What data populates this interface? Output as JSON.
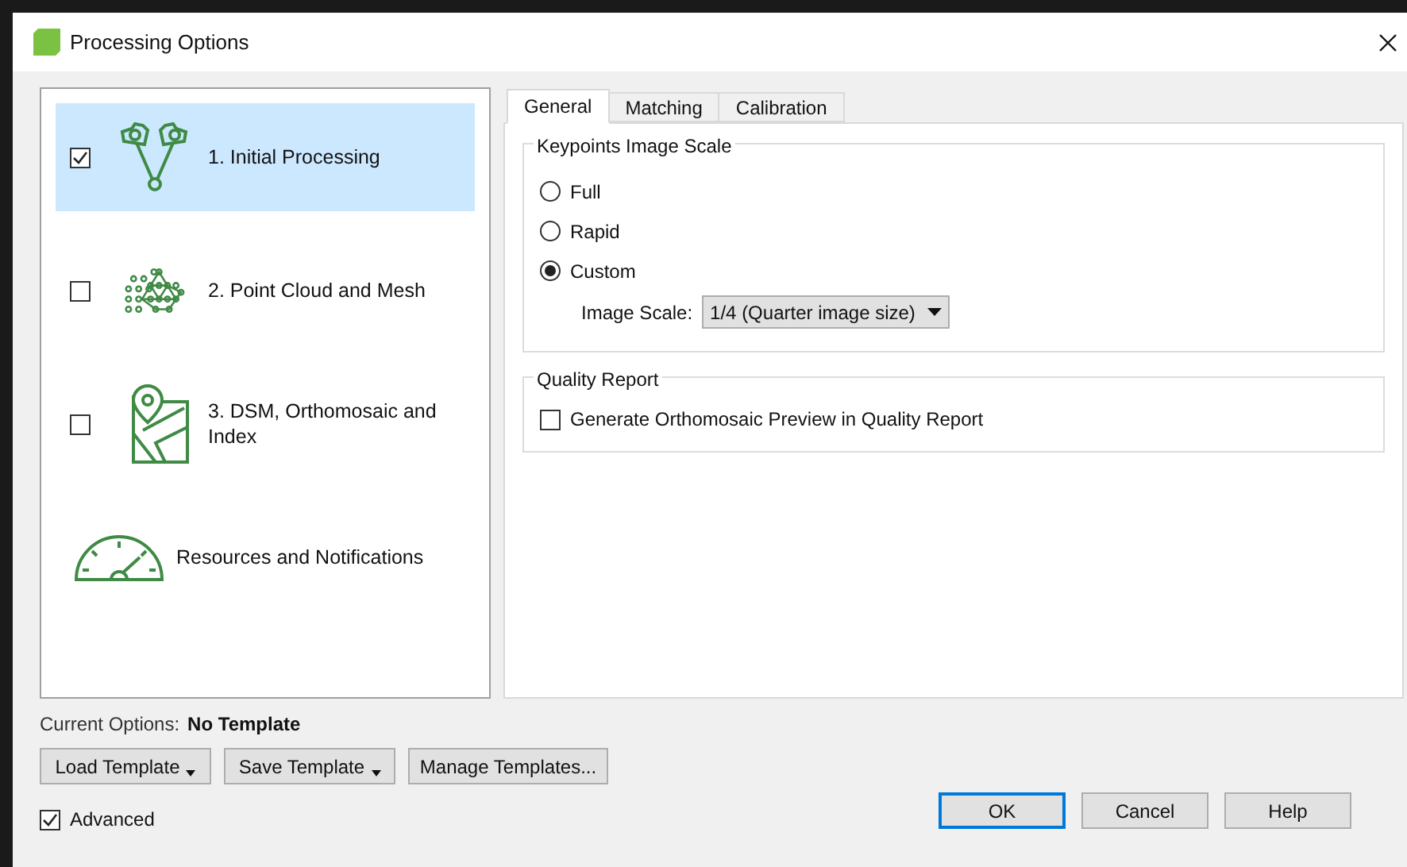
{
  "window": {
    "title": "Processing Options"
  },
  "steps": [
    {
      "kind": "cameras",
      "label": "1. Initial Processing",
      "checked": true,
      "selected": true
    },
    {
      "kind": "pointcloud",
      "label": "2. Point Cloud and Mesh",
      "checked": false,
      "selected": false
    },
    {
      "kind": "map",
      "label": "3. DSM, Orthomosaic and Index",
      "checked": false,
      "selected": false
    },
    {
      "kind": "gauge",
      "label": "Resources and Notifications",
      "selected": false
    }
  ],
  "tabs": [
    {
      "label": "General",
      "selected": true
    },
    {
      "label": "Matching",
      "selected": false
    },
    {
      "label": "Calibration",
      "selected": false
    }
  ],
  "keypoints": {
    "title": "Keypoints Image Scale",
    "options": [
      {
        "label": "Full",
        "selected": false
      },
      {
        "label": "Rapid",
        "selected": false
      },
      {
        "label": "Custom",
        "selected": true
      }
    ],
    "scale_label": "Image Scale:",
    "scale_value": "1/4 (Quarter image size)"
  },
  "quality_report": {
    "title": "Quality Report",
    "option": {
      "label": "Generate Orthomosaic Preview in Quality Report",
      "checked": false
    }
  },
  "current_options": {
    "label": "Current Options:",
    "value": "No Template"
  },
  "template_buttons": [
    {
      "label": "Load Template",
      "menu": true
    },
    {
      "label": "Save Template",
      "menu": true
    },
    {
      "label": "Manage Templates...",
      "menu": false
    }
  ],
  "advanced": {
    "label": "Advanced",
    "checked": true
  },
  "buttons": [
    {
      "label": "OK",
      "default": true
    },
    {
      "label": "Cancel",
      "default": false
    },
    {
      "label": "Help",
      "default": false
    }
  ]
}
